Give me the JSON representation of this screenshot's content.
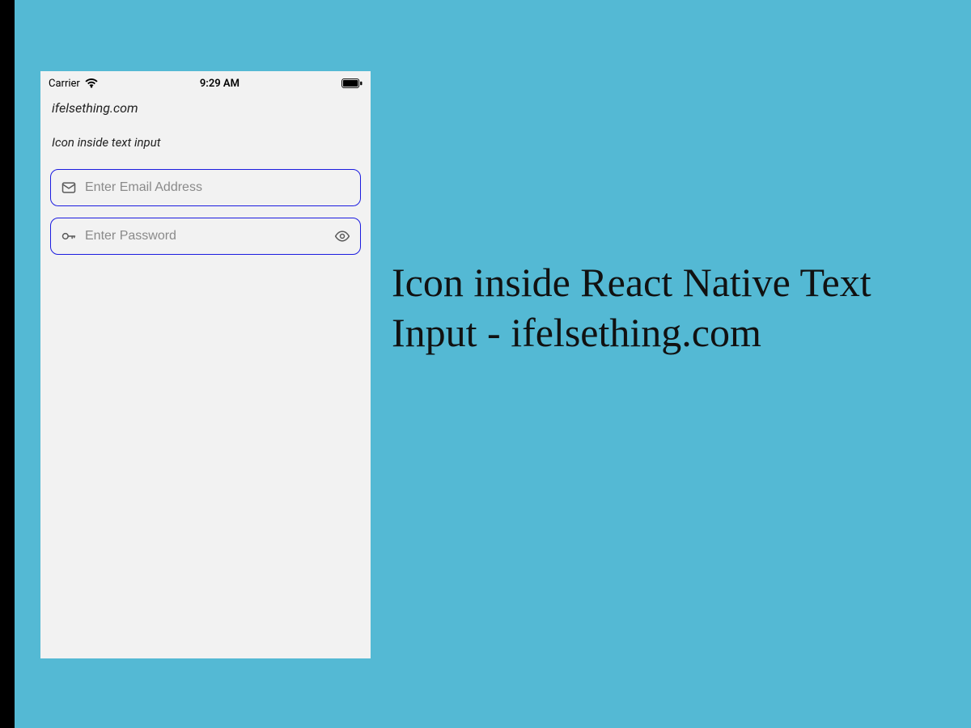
{
  "status_bar": {
    "carrier": "Carrier",
    "time": "9:29 AM"
  },
  "app": {
    "title": "ifelsething.com",
    "subtitle": "Icon inside text input",
    "email_placeholder": "Enter Email Address",
    "password_placeholder": "Enter Password"
  },
  "headline": "Icon inside React Native Text Input - ifelsething.com",
  "colors": {
    "page_bg": "#54b9d4",
    "phone_bg": "#f2f2f2",
    "field_border": "#1c1ce0"
  }
}
